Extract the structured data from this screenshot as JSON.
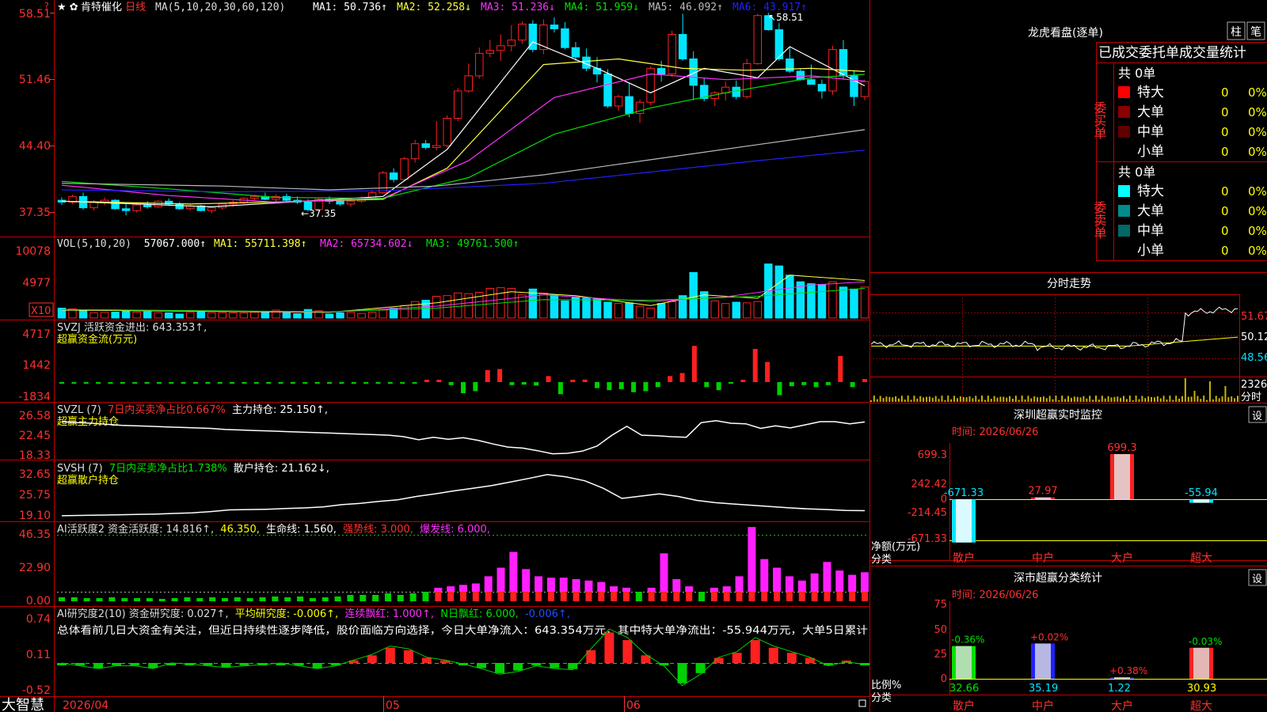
{
  "colors": {
    "up": "#ff2020",
    "down": "#00e5ff",
    "grid": "#c00000",
    "ma1": "#ffffff",
    "ma2": "#ffff40",
    "ma3": "#ff30ff",
    "ma4": "#00e000",
    "ma5": "#bbbbbb",
    "ma6": "#2020ff",
    "yellow": "#ffff00"
  },
  "main": {
    "title_icons": "★ ✿",
    "stock_name": "肯特催化",
    "period": "日线",
    "ma_def": "MA(5,10,20,30,60,120)",
    "ma_items": [
      {
        "label": "MA1: 50.736↑",
        "color": "#ffffff"
      },
      {
        "label": "MA2: 52.258↓",
        "color": "#ffff40"
      },
      {
        "label": "MA3: 51.236↓",
        "color": "#ff30ff"
      },
      {
        "label": "MA4: 51.959↓",
        "color": "#00e000"
      },
      {
        "label": "MA5: 46.092↑",
        "color": "#bbbbbb"
      },
      {
        "label": "MA6: 43.917↑",
        "color": "#2020ff"
      }
    ],
    "y_ticks": [
      "58.51",
      "51.46",
      "44.40",
      "37.35"
    ],
    "high_label": "58.51",
    "low_label": "37.35"
  },
  "chart_data": {
    "type": "candlestick",
    "price_ylim": [
      37.35,
      58.51
    ],
    "candles": [
      [
        38.6,
        38.9,
        38.1,
        38.4
      ],
      [
        38.4,
        39.2,
        38.2,
        39.0
      ],
      [
        39.0,
        39.4,
        37.6,
        37.8
      ],
      [
        37.8,
        38.6,
        37.5,
        38.4
      ],
      [
        38.4,
        38.9,
        38.1,
        38.6
      ],
      [
        38.6,
        38.7,
        37.6,
        37.7
      ],
      [
        37.7,
        38.2,
        37.0,
        37.5
      ],
      [
        37.5,
        38.3,
        37.3,
        38.1
      ],
      [
        38.1,
        38.5,
        37.7,
        37.9
      ],
      [
        37.9,
        38.6,
        37.8,
        38.5
      ],
      [
        38.5,
        38.8,
        38.0,
        38.2
      ],
      [
        38.2,
        38.4,
        37.6,
        37.7
      ],
      [
        37.7,
        38.2,
        37.5,
        38.0
      ],
      [
        38.0,
        38.1,
        37.4,
        37.5
      ],
      [
        37.5,
        37.9,
        37.2,
        37.8
      ],
      [
        37.8,
        38.3,
        37.6,
        38.2
      ],
      [
        38.2,
        38.6,
        37.9,
        38.4
      ],
      [
        38.4,
        38.9,
        38.2,
        38.8
      ],
      [
        38.8,
        39.2,
        38.5,
        39.0
      ],
      [
        39.0,
        39.4,
        38.6,
        38.7
      ],
      [
        38.7,
        39.2,
        38.3,
        39.0
      ],
      [
        39.0,
        39.3,
        38.4,
        38.6
      ],
      [
        38.6,
        39.0,
        38.2,
        38.4
      ],
      [
        38.4,
        38.7,
        37.4,
        37.6
      ],
      [
        37.6,
        38.8,
        37.3,
        38.7
      ],
      [
        38.7,
        39.0,
        38.2,
        38.5
      ],
      [
        38.5,
        38.8,
        38.0,
        38.2
      ],
      [
        38.2,
        38.6,
        37.9,
        38.5
      ],
      [
        38.5,
        39.0,
        38.3,
        38.8
      ],
      [
        38.8,
        39.6,
        38.6,
        39.4
      ],
      [
        39.4,
        41.7,
        39.3,
        41.5
      ],
      [
        41.5,
        42.0,
        40.5,
        40.8
      ],
      [
        40.8,
        43.2,
        40.7,
        43.0
      ],
      [
        43.0,
        45.0,
        42.6,
        44.6
      ],
      [
        44.6,
        45.0,
        44.0,
        44.2
      ],
      [
        44.2,
        47.0,
        43.9,
        44.4
      ],
      [
        44.4,
        47.6,
        44.2,
        47.3
      ],
      [
        47.3,
        50.5,
        47.0,
        50.2
      ],
      [
        50.2,
        53.1,
        50.0,
        51.8
      ],
      [
        51.8,
        54.8,
        51.5,
        54.2
      ],
      [
        54.2,
        55.6,
        53.8,
        54.5
      ],
      [
        54.5,
        56.2,
        53.4,
        55.0
      ],
      [
        55.0,
        57.2,
        54.4,
        55.6
      ],
      [
        55.6,
        57.6,
        55.2,
        57.3
      ],
      [
        57.3,
        57.7,
        54.3,
        54.6
      ],
      [
        54.6,
        57.8,
        54.1,
        57.2
      ],
      [
        57.2,
        58.0,
        56.4,
        56.8
      ],
      [
        56.8,
        57.5,
        54.6,
        54.8
      ],
      [
        54.8,
        55.4,
        53.4,
        53.8
      ],
      [
        53.8,
        54.7,
        52.3,
        52.6
      ],
      [
        52.6,
        53.8,
        51.1,
        52.0
      ],
      [
        52.0,
        52.5,
        48.4,
        48.6
      ],
      [
        48.6,
        49.8,
        48.1,
        49.6
      ],
      [
        49.6,
        51.0,
        47.4,
        47.8
      ],
      [
        47.8,
        49.3,
        46.8,
        49.0
      ],
      [
        49.0,
        52.8,
        48.7,
        52.6
      ],
      [
        52.6,
        53.4,
        51.2,
        52.0
      ],
      [
        52.0,
        56.6,
        51.7,
        56.2
      ],
      [
        56.2,
        58.4,
        53.4,
        53.6
      ],
      [
        53.6,
        54.4,
        49.2,
        50.8
      ],
      [
        50.8,
        51.6,
        49.1,
        49.4
      ],
      [
        49.4,
        50.2,
        48.6,
        50.0
      ],
      [
        50.0,
        51.2,
        49.2,
        50.6
      ],
      [
        50.6,
        51.3,
        49.3,
        49.6
      ],
      [
        49.6,
        53.6,
        49.4,
        53.1
      ],
      [
        53.1,
        58.4,
        53.0,
        58.2
      ],
      [
        58.2,
        58.5,
        56.6,
        56.7
      ],
      [
        56.7,
        57.4,
        53.4,
        53.6
      ],
      [
        53.6,
        54.8,
        52.1,
        52.3
      ],
      [
        52.3,
        52.6,
        51.3,
        51.4
      ],
      [
        51.4,
        53.0,
        51.0,
        50.9
      ],
      [
        50.9,
        51.4,
        49.4,
        50.2
      ],
      [
        50.2,
        55.0,
        49.8,
        54.6
      ],
      [
        54.6,
        55.6,
        51.4,
        51.8
      ],
      [
        51.8,
        52.4,
        48.6,
        49.6
      ],
      [
        49.6,
        51.4,
        49.2,
        51.2
      ]
    ],
    "ma_series": {
      "MA1": [
        [
          0,
          38.5
        ],
        [
          14,
          37.9
        ],
        [
          30,
          39.0
        ],
        [
          36,
          44.0
        ],
        [
          44,
          55.4
        ],
        [
          50,
          52.6
        ],
        [
          55,
          50.0
        ],
        [
          60,
          52.6
        ],
        [
          65,
          51.6
        ],
        [
          68,
          54.9
        ],
        [
          75,
          50.74
        ]
      ],
      "MA2": [
        [
          0,
          38.5
        ],
        [
          12,
          38.2
        ],
        [
          30,
          38.7
        ],
        [
          36,
          42.0
        ],
        [
          45,
          53.0
        ],
        [
          52,
          53.6
        ],
        [
          58,
          52.6
        ],
        [
          64,
          52.4
        ],
        [
          70,
          52.6
        ],
        [
          75,
          52.26
        ]
      ],
      "MA3": [
        [
          0,
          40.2
        ],
        [
          10,
          39.1
        ],
        [
          20,
          38.4
        ],
        [
          30,
          38.8
        ],
        [
          38,
          42.8
        ],
        [
          46,
          49.5
        ],
        [
          55,
          52.0
        ],
        [
          62,
          51.4
        ],
        [
          70,
          51.8
        ],
        [
          75,
          51.24
        ]
      ],
      "MA4": [
        [
          0,
          40.6
        ],
        [
          10,
          39.8
        ],
        [
          20,
          38.9
        ],
        [
          30,
          38.8
        ],
        [
          38,
          41.0
        ],
        [
          46,
          45.6
        ],
        [
          55,
          48.4
        ],
        [
          62,
          50.0
        ],
        [
          70,
          51.6
        ],
        [
          75,
          51.96
        ]
      ],
      "MA5": [
        [
          0,
          40.4
        ],
        [
          15,
          40.1
        ],
        [
          25,
          39.7
        ],
        [
          35,
          40.1
        ],
        [
          45,
          41.3
        ],
        [
          55,
          42.9
        ],
        [
          65,
          44.5
        ],
        [
          75,
          46.09
        ]
      ],
      "MA6": [
        [
          0,
          39.7
        ],
        [
          15,
          39.5
        ],
        [
          30,
          39.6
        ],
        [
          45,
          40.4
        ],
        [
          55,
          41.6
        ],
        [
          65,
          42.8
        ],
        [
          75,
          43.92
        ]
      ]
    },
    "volume": [
      1500,
      1400,
      1250,
      800,
      850,
      900,
      1100,
      900,
      950,
      800,
      780,
      600,
      850,
      900,
      800,
      820,
      780,
      750,
      900,
      850,
      1200,
      800,
      650,
      1300,
      1100,
      600,
      800,
      850,
      700,
      900,
      1200,
      1500,
      1900,
      2500,
      2700,
      3300,
      3400,
      3800,
      3700,
      3900,
      4500,
      4600,
      4500,
      3500,
      4400,
      3800,
      3500,
      2600,
      3200,
      3000,
      2900,
      2400,
      2200,
      2300,
      1800,
      1500,
      2200,
      2500,
      3400,
      6900,
      4000,
      2600,
      2200,
      2400,
      2300,
      2500,
      8200,
      7900,
      6500,
      5500,
      5200,
      5100,
      5500,
      4700,
      4400,
      4700
    ],
    "vol_ma": {
      "MA1": [
        [
          0,
          1200
        ],
        [
          25,
          850
        ],
        [
          35,
          2300
        ],
        [
          42,
          4000
        ],
        [
          48,
          3400
        ],
        [
          55,
          1900
        ],
        [
          60,
          3500
        ],
        [
          65,
          3000
        ],
        [
          68,
          6500
        ],
        [
          75,
          5700
        ]
      ],
      "MA2": [
        [
          0,
          1300
        ],
        [
          25,
          900
        ],
        [
          35,
          1800
        ],
        [
          45,
          3500
        ],
        [
          55,
          2500
        ],
        [
          62,
          3200
        ],
        [
          70,
          5000
        ],
        [
          75,
          5500
        ]
      ],
      "MA3": [
        [
          0,
          1300
        ],
        [
          25,
          950
        ],
        [
          35,
          1500
        ],
        [
          45,
          2800
        ],
        [
          55,
          2700
        ],
        [
          65,
          3300
        ],
        [
          75,
          4500
        ]
      ]
    },
    "svzj": [
      0,
      0,
      0,
      0,
      0,
      0,
      0,
      0,
      0,
      0,
      0,
      0,
      0,
      0,
      0,
      0,
      0,
      0,
      0,
      0,
      0,
      0,
      0,
      0,
      0,
      0,
      0,
      0,
      0,
      0,
      100,
      50,
      -300,
      -1100,
      -900,
      1200,
      1300,
      -300,
      -250,
      -350,
      600,
      -1200,
      200,
      250,
      -600,
      -800,
      -700,
      -1000,
      -900,
      -500,
      600,
      900,
      3600,
      -500,
      -800,
      0,
      200,
      3300,
      2000,
      -1300,
      -400,
      -300,
      -500,
      -300,
      2600,
      -500,
      300
    ],
    "svzl": [
      25.2,
      25.0,
      24.9,
      24.7,
      24.5,
      24.4,
      24.3,
      24.2,
      24.1,
      24.0,
      23.9,
      23.7,
      23.6,
      23.5,
      23.4,
      23.3,
      23.2,
      23.1,
      23.0,
      22.9,
      22.8,
      22.7,
      22.6,
      22.3,
      21.7,
      22.2,
      21.8,
      22.1,
      21.6,
      20.9,
      20.3,
      20.1,
      19.6,
      19.0,
      19.1,
      19.5,
      20.5,
      22.6,
      24.3,
      22.6,
      22.5,
      22.3,
      22.2,
      25.0,
      25.4,
      24.9,
      24.8,
      23.9,
      24.4,
      24.0,
      24.6,
      25.2,
      25.2,
      24.8,
      25.15
    ],
    "svsh": [
      19.6,
      19.7,
      19.8,
      19.9,
      20.0,
      20.1,
      20.3,
      20.5,
      20.9,
      21.4,
      21.5,
      21.6,
      21.8,
      22.0,
      22.3,
      23.0,
      23.4,
      24.0,
      24.5,
      25.5,
      26.3,
      27.2,
      28.0,
      28.8,
      29.9,
      31.0,
      32.2,
      31.5,
      30.3,
      28.0,
      24.9,
      25.6,
      26.3,
      25.5,
      24.3,
      23.6,
      23.2,
      22.8,
      22.4,
      22.0,
      21.7,
      21.5,
      21.2,
      21.16
    ],
    "ai": [
      0.5,
      0.5,
      0.4,
      0.4,
      0.5,
      0.4,
      0.4,
      0.4,
      0.3,
      0.4,
      0.5,
      0.4,
      0.5,
      0.4,
      0.5,
      0.4,
      0.5,
      0.6,
      0.5,
      0.6,
      0.4,
      0.5,
      0.6,
      0.8,
      0.8,
      0.8,
      1.0,
      0.8,
      1.0,
      1.5,
      4.0,
      5.0,
      6.0,
      7.0,
      12.0,
      18.0,
      29.0,
      17.0,
      12.0,
      11.0,
      11.0,
      10.0,
      9.0,
      8.0,
      5.0,
      4.0,
      3.0,
      4.0,
      28.0,
      10.0,
      5.0,
      3.0,
      4.0,
      5.0,
      12.0,
      46.35,
      24.0,
      18.0,
      12.0,
      9.0,
      14.0,
      22.0,
      16.0,
      13.0,
      14.816
    ],
    "ai2": [
      0.0,
      -0.05,
      -0.1,
      -0.05,
      -0.05,
      -0.1,
      0.0,
      -0.02,
      -0.05,
      -0.08,
      -0.05,
      -0.03,
      0.0,
      -0.05,
      -0.1,
      -0.05,
      0.05,
      0.15,
      0.3,
      0.25,
      0.1,
      0.05,
      -0.02,
      -0.1,
      -0.2,
      -0.15,
      -0.05,
      -0.1,
      -0.12,
      0.25,
      0.6,
      0.45,
      0.15,
      -0.05,
      -0.4,
      -0.2,
      0.1,
      0.2,
      0.45,
      0.3,
      0.2,
      0.1,
      -0.05,
      0.02,
      -0.027
    ]
  },
  "vol_panel": {
    "title": "VOL(5,10,20)",
    "val": "57067.000↑",
    "items": [
      {
        "label": "MA1: 55711.398↑",
        "color": "#ffff40"
      },
      {
        "label": "MA2: 65734.602↓",
        "color": "#ff30ff"
      },
      {
        "label": "MA3: 49761.500↑",
        "color": "#00e000"
      }
    ],
    "y_ticks": [
      "10078",
      "4977"
    ],
    "unit": "X10"
  },
  "svzj_panel": {
    "line1": "SVZJ  活跃资金进出: 643.353↑,",
    "line2": "超赢资金流(万元)",
    "y_ticks": [
      "4717",
      "1442",
      "-1834"
    ]
  },
  "svzl_panel": {
    "title": "SVZL (7)",
    "pct": "7日内买卖净占比0.667%",
    "main": "主力持仓: 25.150↑,",
    "line2": "超赢主力持仓",
    "y_ticks": [
      "26.58",
      "22.45",
      "18.33"
    ]
  },
  "svsh_panel": {
    "title": "SVSH (7)",
    "pct": "7日内买卖净占比1.738%",
    "main": "散户持仓: 21.162↓,",
    "line2": "超赢散户持仓",
    "y_ticks": [
      "32.65",
      "25.75",
      "19.10"
    ]
  },
  "ai_panel": {
    "title": "AI活跃度2 资金活跃度: 14.816↑,",
    "v2": "46.350,",
    "v3": "生命线: 1.560,",
    "v4": "强势线: 3.000,",
    "v5": "爆发线: 6.000,",
    "y_ticks": [
      "46.35",
      "22.90",
      "0.00"
    ]
  },
  "ai2_panel": {
    "title": "AI研究度2(10) 资金研究度: 0.027↑,",
    "v2": "平均研究度: -0.006↑,",
    "v3": "连续飘红: 1.000↑,",
    "v4": "N日飘红: 6.000,",
    "v5": "-0.006↑,",
    "desc": "总体看前几日大资金有关注，但近日持续性逐步降低，股价面临方向选择，今日大单净流入：643.354万元，其中特大单净流出：-55.944万元，大单5日累计",
    "y_ticks": [
      "0.74",
      "0.11",
      "-0.52"
    ]
  },
  "bottom": {
    "brand": "大智慧",
    "date": "2026/04",
    "m1": "05",
    "m2": "06"
  },
  "right": {
    "lhkp_title": "龙虎看盘(逐单)",
    "btn_zhu": "柱",
    "btn_bi": "笔",
    "tabs": [
      "已成交委托单",
      "成交量统计"
    ],
    "buy_label": "委买单",
    "sell_label": "委卖单",
    "buy_total": "共 0单",
    "sell_total": "共 0单",
    "buy_rows": [
      {
        "name": "特大",
        "color": "#ff0000",
        "n": "0",
        "pct": "0%"
      },
      {
        "name": "大单",
        "color": "#8b0000",
        "n": "0",
        "pct": "0%"
      },
      {
        "name": "中单",
        "color": "#600000",
        "n": "0",
        "pct": "0%"
      },
      {
        "name": "小单",
        "color": "",
        "n": "0",
        "pct": "0%"
      }
    ],
    "sell_rows": [
      {
        "name": "特大",
        "color": "#00ffff",
        "n": "0",
        "pct": "0%"
      },
      {
        "name": "大单",
        "color": "#008b8b",
        "n": "0",
        "pct": "0%"
      },
      {
        "name": "中单",
        "color": "#006868",
        "n": "0",
        "pct": "0%"
      },
      {
        "name": "小单",
        "color": "",
        "n": "0",
        "pct": "0%"
      }
    ],
    "fs_title": "分时走势",
    "fs_y": [
      "51.67",
      "50.12",
      "48.56"
    ],
    "fs_vol": "2326",
    "fs_unit": "分时",
    "sz_title": "深圳超赢实时监控",
    "sz_set": "设",
    "sz_time": "时间: 2026/06/26",
    "sz_y": [
      "699.3",
      "242.42",
      "0",
      "-214.45",
      "-671.33"
    ],
    "sz_left1": "净额(万元)",
    "sz_left2": "分类",
    "sz_bars": [
      {
        "cat": "散户",
        "val": -671.33,
        "label": "-671.33"
      },
      {
        "cat": "中户",
        "val": 27.97,
        "label": "27.97"
      },
      {
        "cat": "大户",
        "val": 699.3,
        "label": "699.3"
      },
      {
        "cat": "超大",
        "val": -55.94,
        "label": "-55.94"
      }
    ],
    "ss_title": "深市超赢分类统计",
    "ss_set": "设",
    "ss_time": "时间: 2026/06/26",
    "ss_y": [
      "75",
      "50",
      "25",
      "0"
    ],
    "ss_left1": "比例%",
    "ss_left2": "分类",
    "ss_bars": [
      {
        "cat": "散户",
        "val": 32.66,
        "chg": "-0.36%"
      },
      {
        "cat": "中户",
        "val": 35.19,
        "chg": "+0.02%"
      },
      {
        "cat": "大户",
        "val": 1.22,
        "chg": "+0.38%"
      },
      {
        "cat": "超大",
        "val": 30.93,
        "chg": "-0.03%"
      }
    ]
  }
}
